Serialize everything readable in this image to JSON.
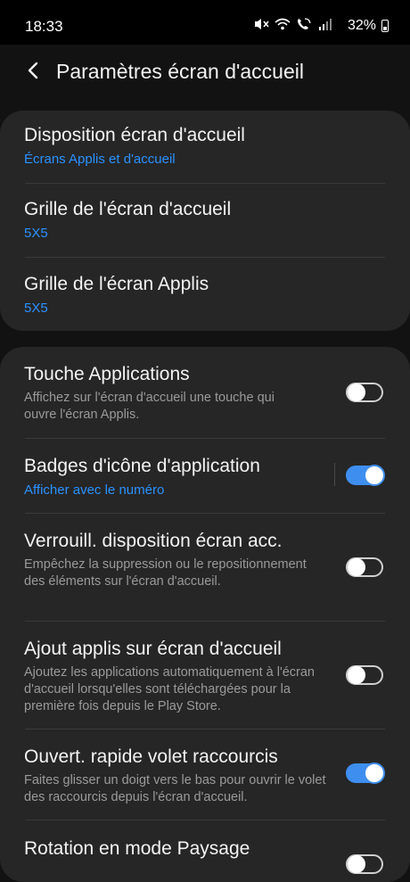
{
  "status": {
    "time": "18:33",
    "battery": "32%",
    "icons": [
      "mute-icon",
      "wifi-icon",
      "wifi-call-icon",
      "signal-icon"
    ]
  },
  "header": {
    "title": "Paramètres écran d'accueil"
  },
  "group1": [
    {
      "title": "Disposition écran d'accueil",
      "value": "Écrans Applis et d'accueil"
    },
    {
      "title": "Grille de l'écran d'accueil",
      "value": "5X5"
    },
    {
      "title": "Grille de l'écran Applis",
      "value": "5X5"
    }
  ],
  "group2": [
    {
      "title": "Touche Applications",
      "desc": "Affichez sur l'écran d'accueil une touche qui ouvre l'écran Applis.",
      "toggle": "off"
    },
    {
      "title": "Badges d'icône d'application",
      "sub": "Afficher avec le numéro",
      "toggle": "on"
    },
    {
      "title": "Verrouill. disposition écran acc.",
      "desc": "Empêchez la suppression ou le repositionnement des éléments sur l'écran d'accueil.",
      "toggle": "off"
    },
    {
      "title": "Ajout applis sur écran d'accueil",
      "desc": "Ajoutez les applications automatiquement à l'écran d'accueil lorsqu'elles sont téléchargées pour la première fois depuis le Play Store.",
      "toggle": "off"
    },
    {
      "title": "Ouvert. rapide volet raccourcis",
      "desc": "Faites glisser un doigt vers le bas pour ouvrir le volet des raccourcis depuis l'écran d'accueil.",
      "toggle": "on"
    },
    {
      "title": "Rotation en mode Paysage",
      "toggle": "off"
    }
  ],
  "colors": {
    "accent": "#2a92ff",
    "toggle_on": "#3e8ef0",
    "card": "#262626",
    "background": "#121212"
  }
}
